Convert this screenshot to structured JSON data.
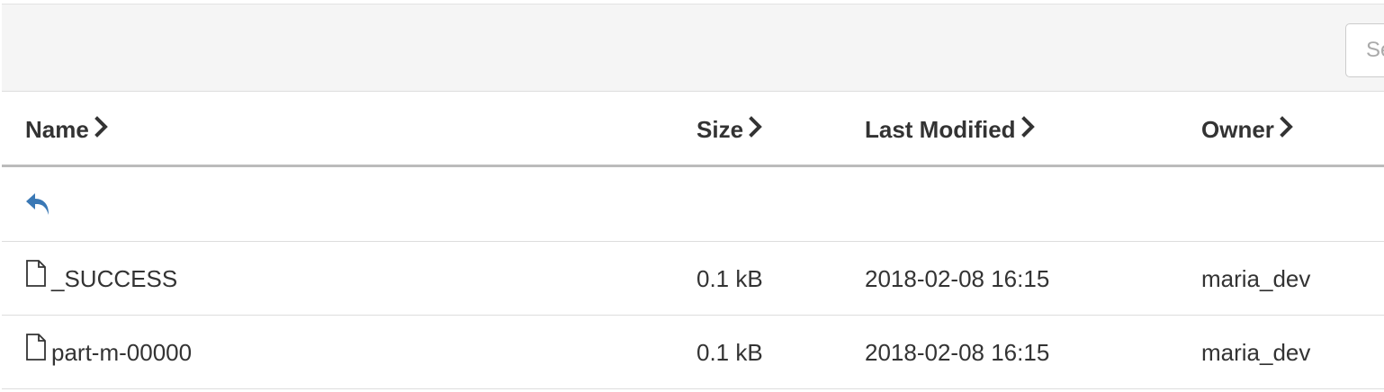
{
  "search": {
    "placeholder": "Search"
  },
  "columns": {
    "name": "Name",
    "size": "Size",
    "last_modified": "Last Modified",
    "owner": "Owner"
  },
  "up_icon": "reply-arrow-icon",
  "rows": [
    {
      "icon": "file-icon",
      "name": "_SUCCESS",
      "size": "0.1 kB",
      "last_modified": "2018-02-08 16:15",
      "owner": "maria_dev"
    },
    {
      "icon": "file-icon",
      "name": "part-m-00000",
      "size": "0.1 kB",
      "last_modified": "2018-02-08 16:15",
      "owner": "maria_dev"
    }
  ],
  "colors": {
    "accent": "#3a78b5",
    "toolbar_bg": "#f5f5f5",
    "text": "#333333",
    "divider": "#dddddd"
  }
}
